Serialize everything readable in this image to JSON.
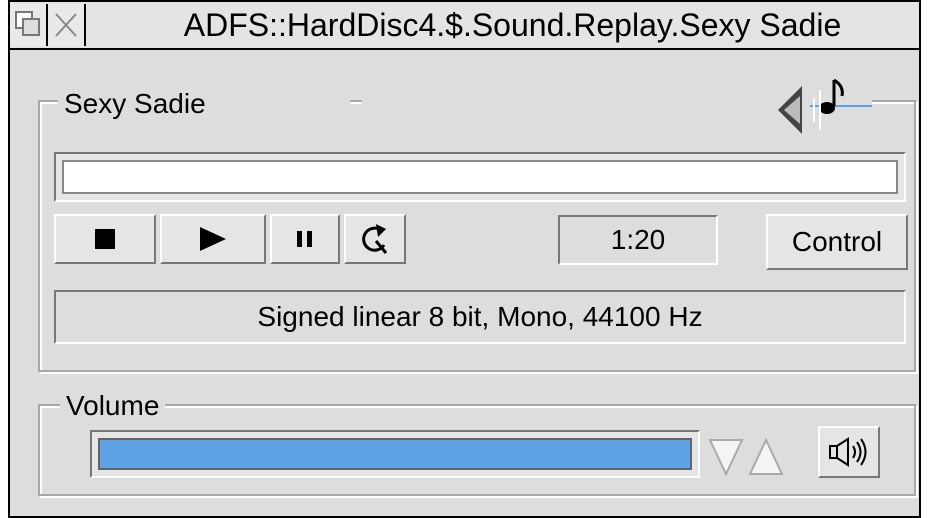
{
  "window": {
    "title": "ADFS::HardDisc4.$.Sound.Replay.Sexy Sadie"
  },
  "player": {
    "track_label": "Sexy Sadie",
    "progress": 0.0,
    "time": "1:20",
    "control_label": "Control",
    "format_info": "Signed linear 8 bit, Mono, 44100 Hz",
    "buttons": [
      "stop-icon",
      "play-icon",
      "pause-icon",
      "loop-icon"
    ]
  },
  "volume": {
    "label": "Volume",
    "level": 1.0,
    "colors": {
      "bar": "#5ea2e6",
      "background": "#dddddd"
    }
  }
}
